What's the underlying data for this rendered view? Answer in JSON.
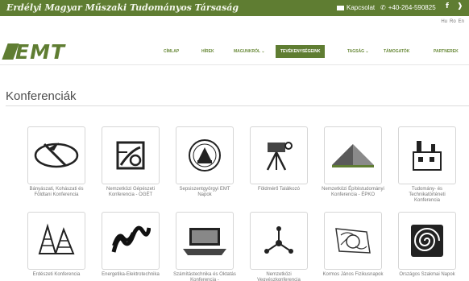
{
  "topbar": {
    "org_name": "Erdélyi Magyar Műszaki Tudományos Társaság",
    "contact_label": "Kapcsolat",
    "phone": "+40-264-590825",
    "facebook_glyph": "f",
    "twitter_glyph": "❱"
  },
  "languages": [
    "Hu",
    "Ro",
    "En"
  ],
  "logo": {
    "text": "EMT"
  },
  "nav": {
    "items": [
      {
        "label": "CÍMLAP"
      },
      {
        "label": "HÍREK"
      },
      {
        "label": "MAGUNKRÓL ⌄"
      },
      {
        "label": "TEVÉKENYSÉGEINK"
      },
      {
        "label": "TAGSÁG ⌄"
      },
      {
        "label": "TÁMOGATÓK"
      },
      {
        "label": "PARTNEREK"
      }
    ],
    "active_index": 3
  },
  "page": {
    "title": "Konferenciák"
  },
  "conferences": [
    {
      "label": "Bányászati, Kohászati és Földtani Konferencia",
      "icon": "mining-icon"
    },
    {
      "label": "Nemzetközi Gépészeti Konferencia - OGÉT",
      "icon": "gear-machine-icon"
    },
    {
      "label": "Sepsiszentgyörgyi EMT Napok",
      "icon": "emblem-icon"
    },
    {
      "label": "Földmérő Találkozó",
      "icon": "surveyor-icon"
    },
    {
      "label": "Nemzetközi Építéstudományi Konferencia - ÉPKO",
      "icon": "roof-icon"
    },
    {
      "label": "Tudomány- és Technikatörténeti Konferencia",
      "icon": "factory-icon"
    },
    {
      "label": "Erdészeti Konferencia",
      "icon": "trees-icon"
    },
    {
      "label": "Energetika-Elektrotechnika",
      "icon": "energy-waves-icon"
    },
    {
      "label": "Számítástechnika és Oktatás Konferencia -",
      "icon": "laptop-icon"
    },
    {
      "label": "Nemzetközi Vegyészkonferencia",
      "icon": "molecule-icon"
    },
    {
      "label": "Kormos János Fizikusnapok",
      "icon": "physics-sketch-icon"
    },
    {
      "label": "Országos Szakmai Napok",
      "icon": "spiral-icon"
    }
  ],
  "colors": {
    "brand_green": "#5f7d32",
    "text_gray": "#777777"
  }
}
